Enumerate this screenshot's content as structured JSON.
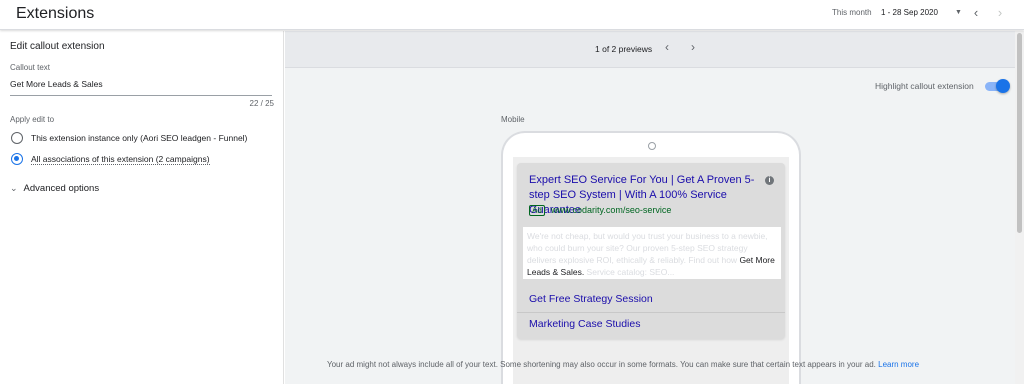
{
  "header": {
    "title": "Extensions",
    "date_label": "This month",
    "date_range": "1 - 28 Sep 2020",
    "dropdown_icon": "caret-down-icon",
    "prev_icon": "chevron-left-icon",
    "next_icon": "chevron-right-icon"
  },
  "editor": {
    "heading": "Edit callout extension",
    "callout_label": "Callout text",
    "callout_value": "Get More Leads & Sales",
    "char_count": "22 / 25",
    "apply_label": "Apply edit to",
    "options": [
      {
        "label": "This extension instance only (Aori SEO leadgen - Funnel)",
        "checked": false
      },
      {
        "label": "All associations of this extension (2 campaigns)",
        "checked": true
      }
    ],
    "advanced": "Advanced options"
  },
  "preview": {
    "count": "1 of 2 previews",
    "highlight_label": "Highlight callout extension",
    "highlight_on": true,
    "device_label": "Mobile",
    "ad": {
      "title": "Expert SEO Service For You | Get A Proven 5-step SEO System | With A 100% Service Guarantee",
      "badge": "Ad",
      "url": "www.codarity.com/seo-service",
      "desc_before": "We're not cheap, but would you trust your business to a newbie, who could burn your site? Our proven 5-step SEO strategy delivers explosive ROI, ethically & reliably. Find out how ",
      "desc_highlight": "Get More Leads & Sales.",
      "desc_after": " Service catalog: SEO...",
      "sitelinks": [
        "Get Free Strategy Session",
        "Marketing Case Studies"
      ]
    },
    "footer_text": "Your ad might not always include all of your text. Some shortening may also occur in some formats. You can make sure that certain text appears in your ad.",
    "footer_link": "Learn more"
  },
  "colors": {
    "accent": "#1a73e8",
    "ad_title": "#1a0dab",
    "ad_url": "#006621"
  }
}
